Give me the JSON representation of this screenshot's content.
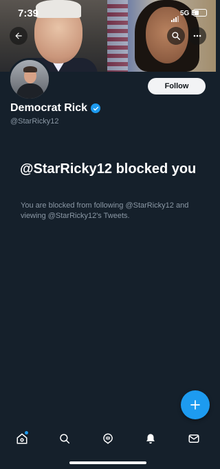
{
  "status_bar": {
    "time": "7:39",
    "network": "5G E"
  },
  "profile": {
    "name": "Democrat Rick",
    "handle": "@StarRicky12",
    "follow_label": "Follow"
  },
  "blocked": {
    "title": "@StarRicky12 blocked you",
    "description": "You are blocked from following @StarRicky12 and viewing @StarRicky12's Tweets."
  },
  "icons": {
    "back": "back-arrow-icon",
    "search": "search-icon",
    "more": "more-icon",
    "verified": "verified-badge-icon",
    "compose": "plus-icon",
    "tabs": [
      "home-icon",
      "search-icon",
      "spaces-icon",
      "notifications-icon",
      "messages-icon"
    ]
  },
  "colors": {
    "background": "#15202b",
    "accent": "#1d9bf0",
    "secondary_text": "#8b98a5"
  }
}
